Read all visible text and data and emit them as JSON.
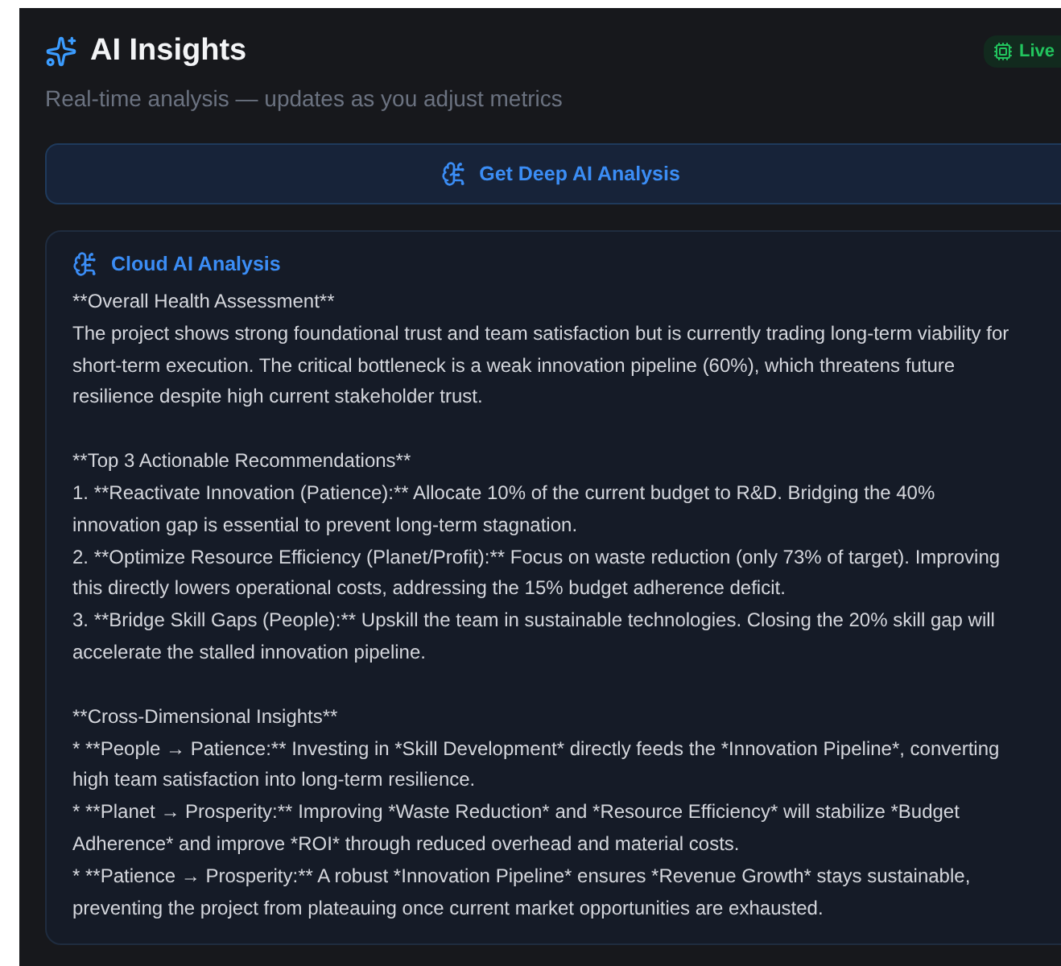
{
  "header": {
    "title": "AI Insights",
    "badge": "Live",
    "subtitle": "Real-time analysis — updates as you adjust metrics"
  },
  "action_button": {
    "label": "Get Deep AI Analysis"
  },
  "analysis_card": {
    "title": "Cloud AI Analysis",
    "sections": [
      {
        "lines": [
          "**Overall Health Assessment**",
          "The project shows strong foundational trust and team satisfaction but is currently trading long-term viability for short-term execution. The critical bottleneck is a weak innovation pipeline (60%), which threatens future resilience despite high current stakeholder trust."
        ]
      },
      {
        "lines": [
          "**Top 3 Actionable Recommendations**",
          "1. **Reactivate Innovation (Patience):** Allocate 10% of the current budget to R&D. Bridging the 40% innovation gap is essential to prevent long-term stagnation.",
          "2. **Optimize Resource Efficiency (Planet/Profit):** Focus on waste reduction (only 73% of target). Improving this directly lowers operational costs, addressing the 15% budget adherence deficit.",
          "3. **Bridge Skill Gaps (People):** Upskill the team in sustainable technologies. Closing the 20% skill gap will accelerate the stalled innovation pipeline."
        ]
      },
      {
        "lines": [
          "**Cross-Dimensional Insights**",
          "* **People → Patience:** Investing in *Skill Development* directly feeds the *Innovation Pipeline*, converting high team satisfaction into long-term resilience.",
          "* **Planet → Prosperity:** Improving *Waste Reduction* and *Resource Efficiency* will stabilize *Budget Adherence* and improve *ROI* through reduced overhead and material costs.",
          "* **Patience → Prosperity:** A robust *Innovation Pipeline* ensures *Revenue Growth* stays sustainable, preventing the project from plateauing once current market opportunities are exhausted."
        ]
      }
    ]
  }
}
